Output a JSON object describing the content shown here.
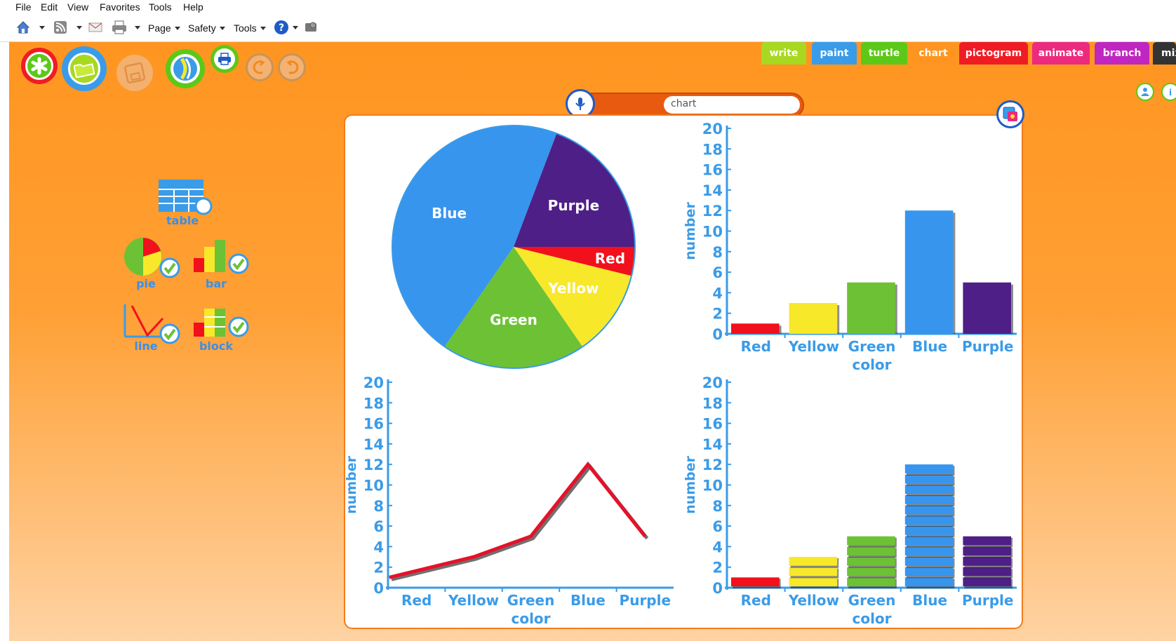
{
  "menu": [
    "File",
    "Edit",
    "View",
    "Favorites",
    "Tools",
    "Help"
  ],
  "toolbar": {
    "page_label": "Page",
    "safety_label": "Safety",
    "tools_label": "Tools"
  },
  "app_tabs": [
    {
      "label": "write",
      "color": "#a8d820"
    },
    {
      "label": "paint",
      "color": "#3a9be8"
    },
    {
      "label": "turtle",
      "color": "#5cc817"
    },
    {
      "label": "chart",
      "color": "#ff9520"
    },
    {
      "label": "pictogram",
      "color": "#f01c24"
    },
    {
      "label": "animate",
      "color": "#ec2a7e"
    },
    {
      "label": "branch",
      "color": "#c026c0"
    },
    {
      "label": "mix",
      "color": "#333333"
    }
  ],
  "search": {
    "value": "chart"
  },
  "chart_tools": {
    "table": "table",
    "pie": "pie",
    "bar": "bar",
    "line": "line",
    "block": "block"
  },
  "colors": {
    "Red": "#f2101c",
    "Yellow": "#f8e82a",
    "Green": "#6cc234",
    "Blue": "#3795ee",
    "Purple": "#4e1f86",
    "axis": "#3a9be8",
    "orange": "#ff9520"
  },
  "chart_data": [
    {
      "type": "pie",
      "categories": [
        "Red",
        "Yellow",
        "Green",
        "Blue",
        "Purple"
      ],
      "values": [
        1,
        3,
        5,
        12,
        5
      ]
    },
    {
      "type": "bar",
      "categories": [
        "Red",
        "Yellow",
        "Green",
        "Blue",
        "Purple"
      ],
      "values": [
        1,
        3,
        5,
        12,
        5
      ],
      "xlabel": "color",
      "ylabel": "number",
      "ylim": [
        0,
        20
      ],
      "yticks": [
        0,
        2,
        4,
        6,
        8,
        10,
        12,
        14,
        16,
        18,
        20
      ]
    },
    {
      "type": "line",
      "categories": [
        "Red",
        "Yellow",
        "Green",
        "Blue",
        "Purple"
      ],
      "values": [
        1,
        3,
        5,
        12,
        5
      ],
      "xlabel": "color",
      "ylabel": "number",
      "ylim": [
        0,
        20
      ],
      "yticks": [
        0,
        2,
        4,
        6,
        8,
        10,
        12,
        14,
        16,
        18,
        20
      ]
    },
    {
      "type": "bar",
      "style": "block",
      "categories": [
        "Red",
        "Yellow",
        "Green",
        "Blue",
        "Purple"
      ],
      "values": [
        1,
        3,
        5,
        12,
        5
      ],
      "xlabel": "color",
      "ylabel": "number",
      "ylim": [
        0,
        20
      ],
      "yticks": [
        0,
        2,
        4,
        6,
        8,
        10,
        12,
        14,
        16,
        18,
        20
      ]
    }
  ]
}
